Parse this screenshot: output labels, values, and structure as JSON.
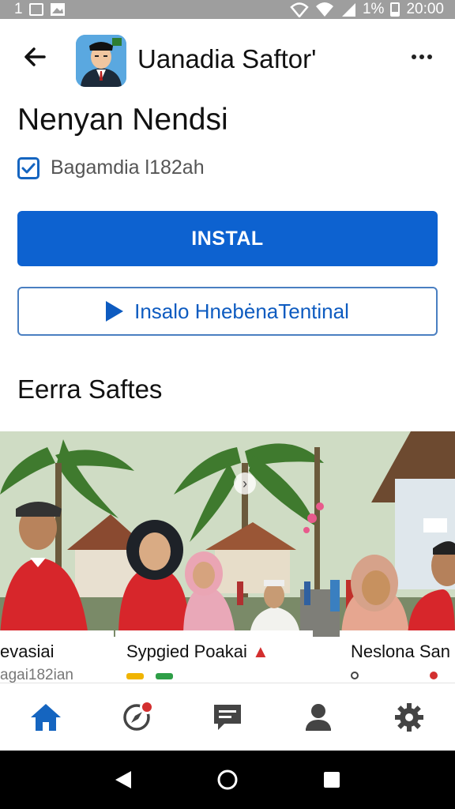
{
  "status_bar": {
    "left_text": "1",
    "battery": "1%",
    "time": "20:00"
  },
  "header": {
    "app_name": "Uanadia Saftor'",
    "back_icon": "arrow-back-icon",
    "more_icon": "more-vert-icon"
  },
  "app": {
    "title": "Nenyan Nendsi",
    "verified_text": "Bagamdia l182ah",
    "install_label": "INSTAL",
    "trailer_label": "Insalo HnebėnaTentinal"
  },
  "section": {
    "title": "Eerra Saftes"
  },
  "gallery": {
    "cards": [
      {
        "name": "evasiai",
        "sub": "agai182ian"
      },
      {
        "name": "Sypgied Poakai",
        "sub": ""
      },
      {
        "name": "Neslona San",
        "sub": ""
      }
    ]
  },
  "bottom_nav": {
    "items": [
      "home-icon",
      "explore-icon",
      "chat-icon",
      "person-icon",
      "settings-icon"
    ],
    "accent": "#1565c0",
    "badge_color": "#d32f2f"
  },
  "colors": {
    "primary": "#0d62d0",
    "status_bar": "#9e9e9e"
  }
}
